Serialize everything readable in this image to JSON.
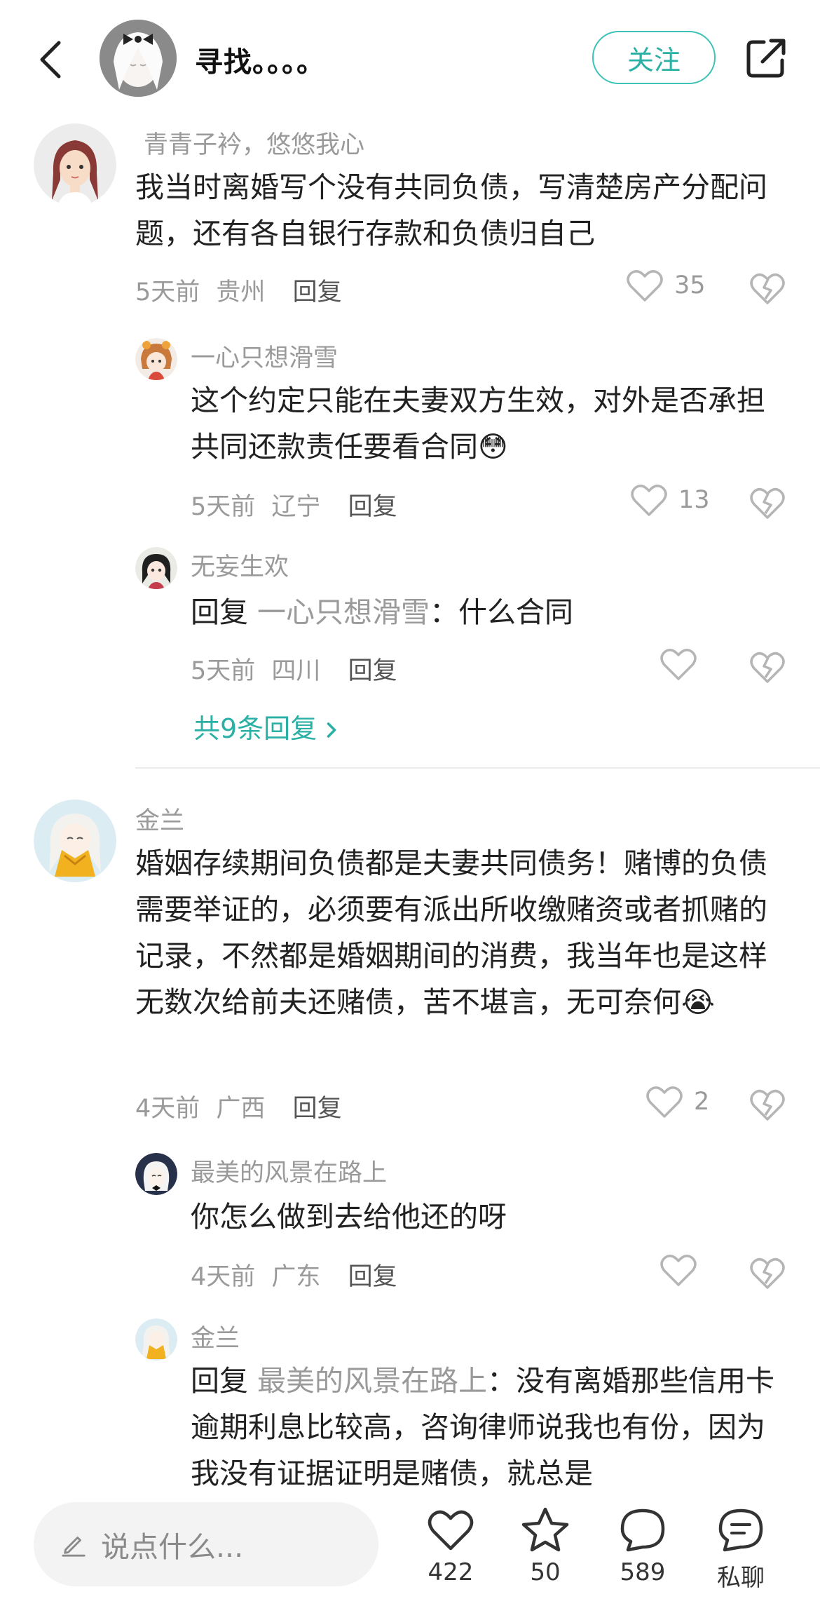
{
  "header": {
    "title": "寻找。。。。",
    "follow_label": "关注"
  },
  "comments": [
    {
      "user": "青青子衿，悠悠我心",
      "text": "我当时离婚写个没有共同负债，写清楚房产分配问题，还有各自银行存款和负债归自己",
      "time": "5天前",
      "location": "贵州",
      "reply_label": "回复",
      "likes": "35",
      "replies": [
        {
          "user": "一心只想滑雪",
          "text": "这个约定只能在夫妻双方生效，对外是否承担共同还款责任要看合同😳",
          "time": "5天前",
          "location": "辽宁",
          "reply_label": "回复",
          "likes": "13"
        },
        {
          "user": "无妄生欢",
          "reply_prefix": "回复",
          "mention": "一心只想滑雪",
          "text": "：什么合同",
          "time": "5天前",
          "location": "四川",
          "reply_label": "回复",
          "likes": ""
        }
      ],
      "more_replies": "共9条回复"
    },
    {
      "user": "金兰",
      "text": "婚姻存续期间负债都是夫妻共同债务！赌博的负债需要举证的，必须要有派出所收缴赌资或者抓赌的记录，不然都是婚姻期间的消费，我当年也是这样无数次给前夫还赌债，苦不堪言，无可奈何😭",
      "time": "4天前",
      "location": "广西",
      "reply_label": "回复",
      "likes": "2",
      "replies": [
        {
          "user": "最美的风景在路上",
          "text": "你怎么做到去给他还的呀",
          "time": "4天前",
          "location": "广东",
          "reply_label": "回复",
          "likes": ""
        },
        {
          "user": "金兰",
          "reply_prefix": "回复",
          "mention": "最美的风景在路上",
          "text": "：没有离婚那些信用卡逾期利息比较高，咨询律师说我也有份，因为我没有证据证明是赌债，就总是"
        }
      ]
    }
  ],
  "bottom_bar": {
    "input_placeholder": "说点什么...",
    "likes": "422",
    "favorites": "50",
    "comments": "589",
    "message_label": "私聊"
  },
  "colors": {
    "accent": "#2ab0a4",
    "muted": "#9a9a9a"
  },
  "icons": [
    "back-arrow-icon",
    "share-icon",
    "heart-icon",
    "broken-heart-icon",
    "pencil-icon",
    "star-icon",
    "speech-bubble-icon",
    "chat-icon",
    "chevron-right-icon"
  ]
}
